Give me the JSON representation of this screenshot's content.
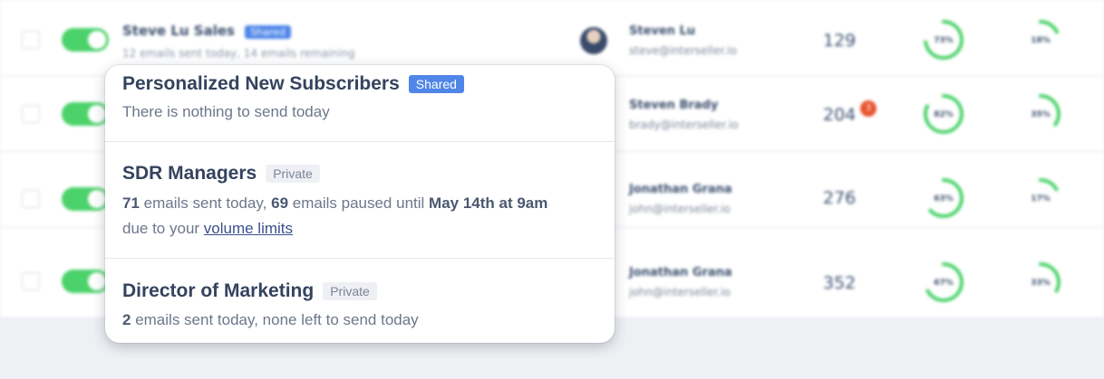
{
  "background_rows": [
    {
      "sequence_name": "Steve Lu Sales",
      "sequence_badge": "Shared",
      "sequence_sub": "12 emails sent today, 14 emails remaining",
      "owner_name": "Steven Lu",
      "owner_email": "steve@interseller.io",
      "count": "129",
      "ring1_label": "73%",
      "ring1_value": 0.73,
      "ring2_label": "18%",
      "ring2_value": 0.18
    },
    {
      "owner_name": "Steven Brady",
      "owner_email": "brady@interseller.io",
      "count": "204",
      "alert_count": "3",
      "ring1_label": "82%",
      "ring1_value": 0.82,
      "ring2_label": "35%",
      "ring2_value": 0.35
    },
    {
      "owner_name": "Jonathan Grana",
      "owner_email": "john@interseller.io",
      "count": "276",
      "ring1_label": "63%",
      "ring1_value": 0.63,
      "ring2_label": "17%",
      "ring2_value": 0.17
    },
    {
      "owner_name": "Jonathan Grana",
      "owner_email": "john@interseller.io",
      "count": "352",
      "ring1_label": "67%",
      "ring1_value": 0.67,
      "ring2_label": "33%",
      "ring2_value": 0.33
    }
  ],
  "popover": {
    "items": [
      {
        "title": "Personalized New Subscribers",
        "badge": "Shared",
        "desc_text": "There is nothing to send today"
      },
      {
        "title": "SDR Managers",
        "badge": "Private",
        "desc_sent_count": "71",
        "desc_sent_text": " emails sent today, ",
        "desc_paused_count": "69",
        "desc_paused_text": " emails paused until ",
        "desc_until": "May 14th at 9am",
        "desc_due_text": "due to your ",
        "desc_link": "volume limits"
      },
      {
        "title": "Director of Marketing",
        "badge": "Private",
        "desc_count": "2",
        "desc_text": " emails sent today, none left to send today"
      }
    ]
  },
  "colors": {
    "accent_blue": "#4f86e8",
    "toggle_green": "#4cd26b",
    "ring_green": "#4cd26b",
    "alert_orange": "#e8532e"
  }
}
